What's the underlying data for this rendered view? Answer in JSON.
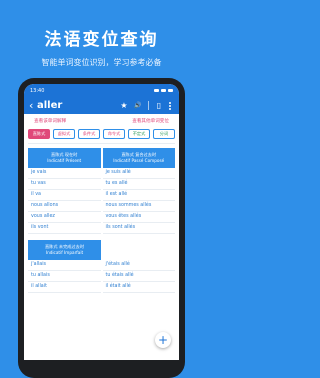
{
  "hero": {
    "title": "法语变位查询",
    "subtitle": "智能单词变位识别，学习参考必备"
  },
  "status": {
    "time": "13:40"
  },
  "appbar": {
    "back_icon": "‹",
    "word": "aller",
    "star_icon": "★",
    "speaker_icon": "🔊",
    "copy_icon": "▯"
  },
  "links": {
    "left": "查看该单词解释",
    "right": "查看其他单词变位"
  },
  "tabs": [
    "直陈式",
    "虚拟式",
    "条件式",
    "命令式",
    "不定式",
    "分词"
  ],
  "table1": {
    "left_head": [
      "直陈式 现在时",
      "Indicatif Présent"
    ],
    "right_head": [
      "直陈式 复合过去时",
      "Indicatif Passé Composé"
    ],
    "left_rows": [
      "je vais",
      "tu vas",
      "il va",
      "nous allons",
      "vous allez",
      "ils vont"
    ],
    "right_rows": [
      "je suis allé",
      "tu es allé",
      "il est allé",
      "nous sommes allés",
      "vous êtes allés",
      "ils sont allés"
    ]
  },
  "table2": {
    "left_head": [
      "直陈式 未完成过去时",
      "Indicatif Imparfait"
    ],
    "left_rows": [
      "j'allais",
      "tu allais",
      "il allait"
    ],
    "right_rows": [
      "j'étais allé",
      "tu étais allé",
      "il était allé"
    ]
  },
  "fab": {
    "label": "+"
  }
}
